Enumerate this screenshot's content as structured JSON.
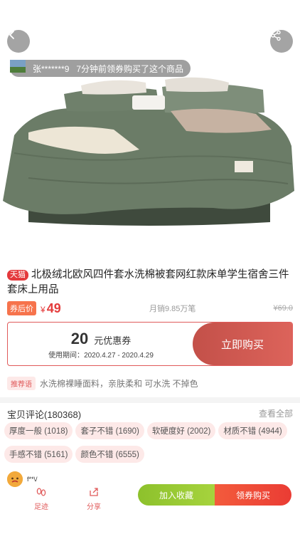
{
  "buyer": {
    "name": "张*******9",
    "message": "7分钟前领券购买了这个商品"
  },
  "product": {
    "platform_tag": "天猫",
    "title": "北极绒北欧风四件套水洗棉被套网红款床单学生宿舍三件套床上用品",
    "after_coupon_tag": "券后价",
    "currency": "¥",
    "price": "49",
    "sales": "月销9.85万笔",
    "original_price": "¥69.0"
  },
  "coupon": {
    "amount": "20",
    "unit_label": "元优惠券",
    "period_label": "使用期间：",
    "period": "2020.4.27 - 2020.4.29",
    "button": "立即购买"
  },
  "recommend": {
    "tag": "推荐语",
    "text": "水洗棉裸睡面料，亲肤柔和 可水洗 不掉色"
  },
  "reviews": {
    "title": "宝贝评论(180368)",
    "see_all": "查看全部",
    "tags": [
      "厚度一般 (1018)",
      "套子不错 (1690)",
      "软硬度好 (2002)",
      "材质不错 (4944)",
      "手感不错 (5161)",
      "颜色不错 (6555)"
    ],
    "first_user": "f**\\/"
  },
  "bottom_bar": {
    "footprint": "足迹",
    "share": "分享",
    "favorite": "加入收藏",
    "buy": "领券购买"
  },
  "colors": {
    "accent_red": "#e43d3d",
    "coupon_button": "#d05a52",
    "favorite_green": "#9ccb36",
    "bedding_green": "#6c7d68"
  }
}
